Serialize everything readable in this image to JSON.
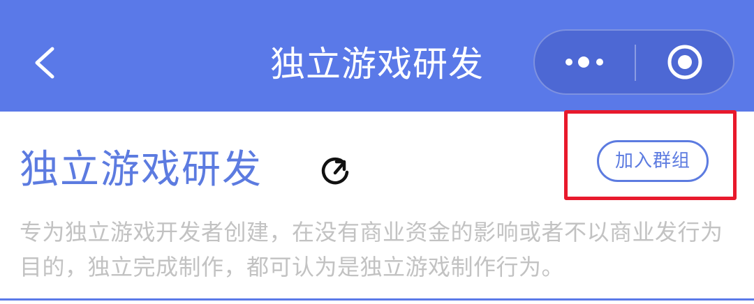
{
  "navbar": {
    "title": "独立游戏研发",
    "back_icon": "chevron-left-icon",
    "more_icon": "more-dots-icon",
    "close_icon": "target-close-icon",
    "background": "#5a79e8"
  },
  "group": {
    "title": "独立游戏研发",
    "refresh_icon": "refresh-icon",
    "join_label": "加入群组",
    "description": "专为独立游戏开发者创建，在没有商业资金的影响或者不以商业发行为目的，独立完成制作，都可认为是独立游戏制作行为。"
  },
  "colors": {
    "accent": "#5c7be0",
    "highlight": "#e8192c",
    "description_text": "#c2c2c2"
  }
}
